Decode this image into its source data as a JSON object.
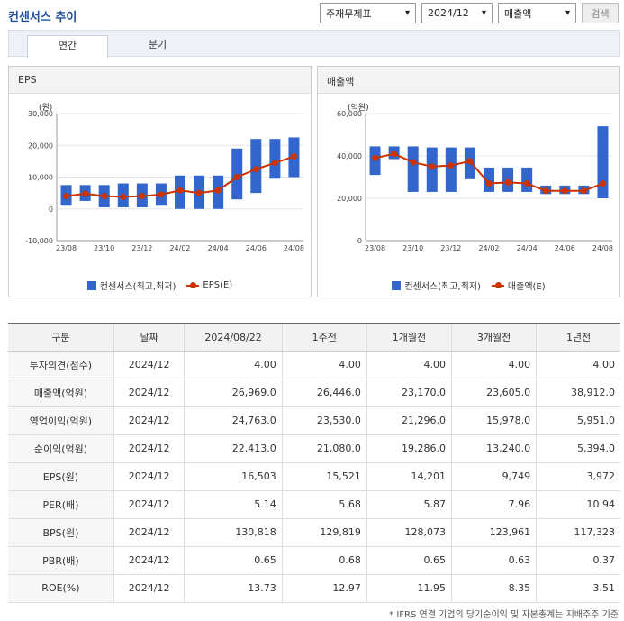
{
  "title": "컨센서스 추이",
  "controls": {
    "filter": "주재무제표",
    "period": "2024/12",
    "metric": "매출액",
    "search": "검색"
  },
  "tabs": [
    "연간",
    "분기"
  ],
  "colors": {
    "bar": "#3366cc",
    "line": "#cc3300"
  },
  "chart_data": [
    {
      "type": "bar",
      "title": "EPS",
      "unit": "(원)",
      "categories": [
        "23/08",
        "23/09",
        "23/10",
        "23/11",
        "23/12",
        "24/01",
        "24/02",
        "24/03",
        "24/04",
        "24/05",
        "24/06",
        "24/07",
        "24/08"
      ],
      "x_tick_labels": [
        "23/08",
        "23/10",
        "23/12",
        "24/02",
        "24/04",
        "24/06",
        "24/08"
      ],
      "y_ticks": [
        "30,000",
        "20,000",
        "10,000",
        "0",
        "-10,000"
      ],
      "ylim": [
        -10000,
        30000
      ],
      "series": [
        {
          "name": "컨센서스(최고,최저)",
          "type": "range",
          "high": [
            7500,
            7500,
            7500,
            8000,
            8000,
            8000,
            10500,
            10500,
            10500,
            19000,
            22000,
            22000,
            22500
          ],
          "low": [
            1000,
            2500,
            500,
            500,
            500,
            1000,
            0,
            0,
            0,
            3000,
            5000,
            9500,
            10000
          ]
        },
        {
          "name": "EPS(E)",
          "type": "line",
          "values": [
            4000,
            4800,
            4000,
            3800,
            4000,
            4500,
            5800,
            5000,
            5800,
            10000,
            12500,
            14500,
            16500
          ]
        }
      ]
    },
    {
      "type": "bar",
      "title": "매출액",
      "unit": "(억원)",
      "categories": [
        "23/08",
        "23/09",
        "23/10",
        "23/11",
        "23/12",
        "24/01",
        "24/02",
        "24/03",
        "24/04",
        "24/05",
        "24/06",
        "24/07",
        "24/08"
      ],
      "x_tick_labels": [
        "23/08",
        "23/10",
        "23/12",
        "24/02",
        "24/04",
        "24/06",
        "24/08"
      ],
      "y_ticks": [
        "60,000",
        "40,000",
        "20,000",
        "0"
      ],
      "ylim": [
        0,
        60000
      ],
      "series": [
        {
          "name": "컨센서스(최고,최저)",
          "type": "range",
          "high": [
            44500,
            44500,
            44500,
            44000,
            44000,
            44000,
            34500,
            34500,
            34500,
            26000,
            26000,
            26000,
            54000
          ],
          "low": [
            31000,
            38500,
            23000,
            23000,
            23000,
            29000,
            23000,
            23000,
            23000,
            22000,
            22000,
            22000,
            20000
          ]
        },
        {
          "name": "매출액(E)",
          "type": "line",
          "values": [
            39000,
            41000,
            37000,
            35000,
            35500,
            37500,
            27000,
            27500,
            27000,
            23500,
            23500,
            23500,
            27000
          ]
        }
      ]
    }
  ],
  "table": {
    "headers": [
      "구분",
      "날짜",
      "2024/08/22",
      "1주전",
      "1개월전",
      "3개월전",
      "1년전"
    ],
    "rows": [
      [
        "투자의견(점수)",
        "2024/12",
        "4.00",
        "4.00",
        "4.00",
        "4.00",
        "4.00"
      ],
      [
        "매출액(억원)",
        "2024/12",
        "26,969.0",
        "26,446.0",
        "23,170.0",
        "23,605.0",
        "38,912.0"
      ],
      [
        "영업이익(억원)",
        "2024/12",
        "24,763.0",
        "23,530.0",
        "21,296.0",
        "15,978.0",
        "5,951.0"
      ],
      [
        "순이익(억원)",
        "2024/12",
        "22,413.0",
        "21,080.0",
        "19,286.0",
        "13,240.0",
        "5,394.0"
      ],
      [
        "EPS(원)",
        "2024/12",
        "16,503",
        "15,521",
        "14,201",
        "9,749",
        "3,972"
      ],
      [
        "PER(배)",
        "2024/12",
        "5.14",
        "5.68",
        "5.87",
        "7.96",
        "10.94"
      ],
      [
        "BPS(원)",
        "2024/12",
        "130,818",
        "129,819",
        "128,073",
        "123,961",
        "117,323"
      ],
      [
        "PBR(배)",
        "2024/12",
        "0.65",
        "0.68",
        "0.65",
        "0.63",
        "0.37"
      ],
      [
        "ROE(%)",
        "2024/12",
        "13.73",
        "12.97",
        "11.95",
        "8.35",
        "3.51"
      ]
    ]
  },
  "footnote": "* IFRS 연결 기업의 당기순이익 및 자본총계는 지배주주 기준"
}
